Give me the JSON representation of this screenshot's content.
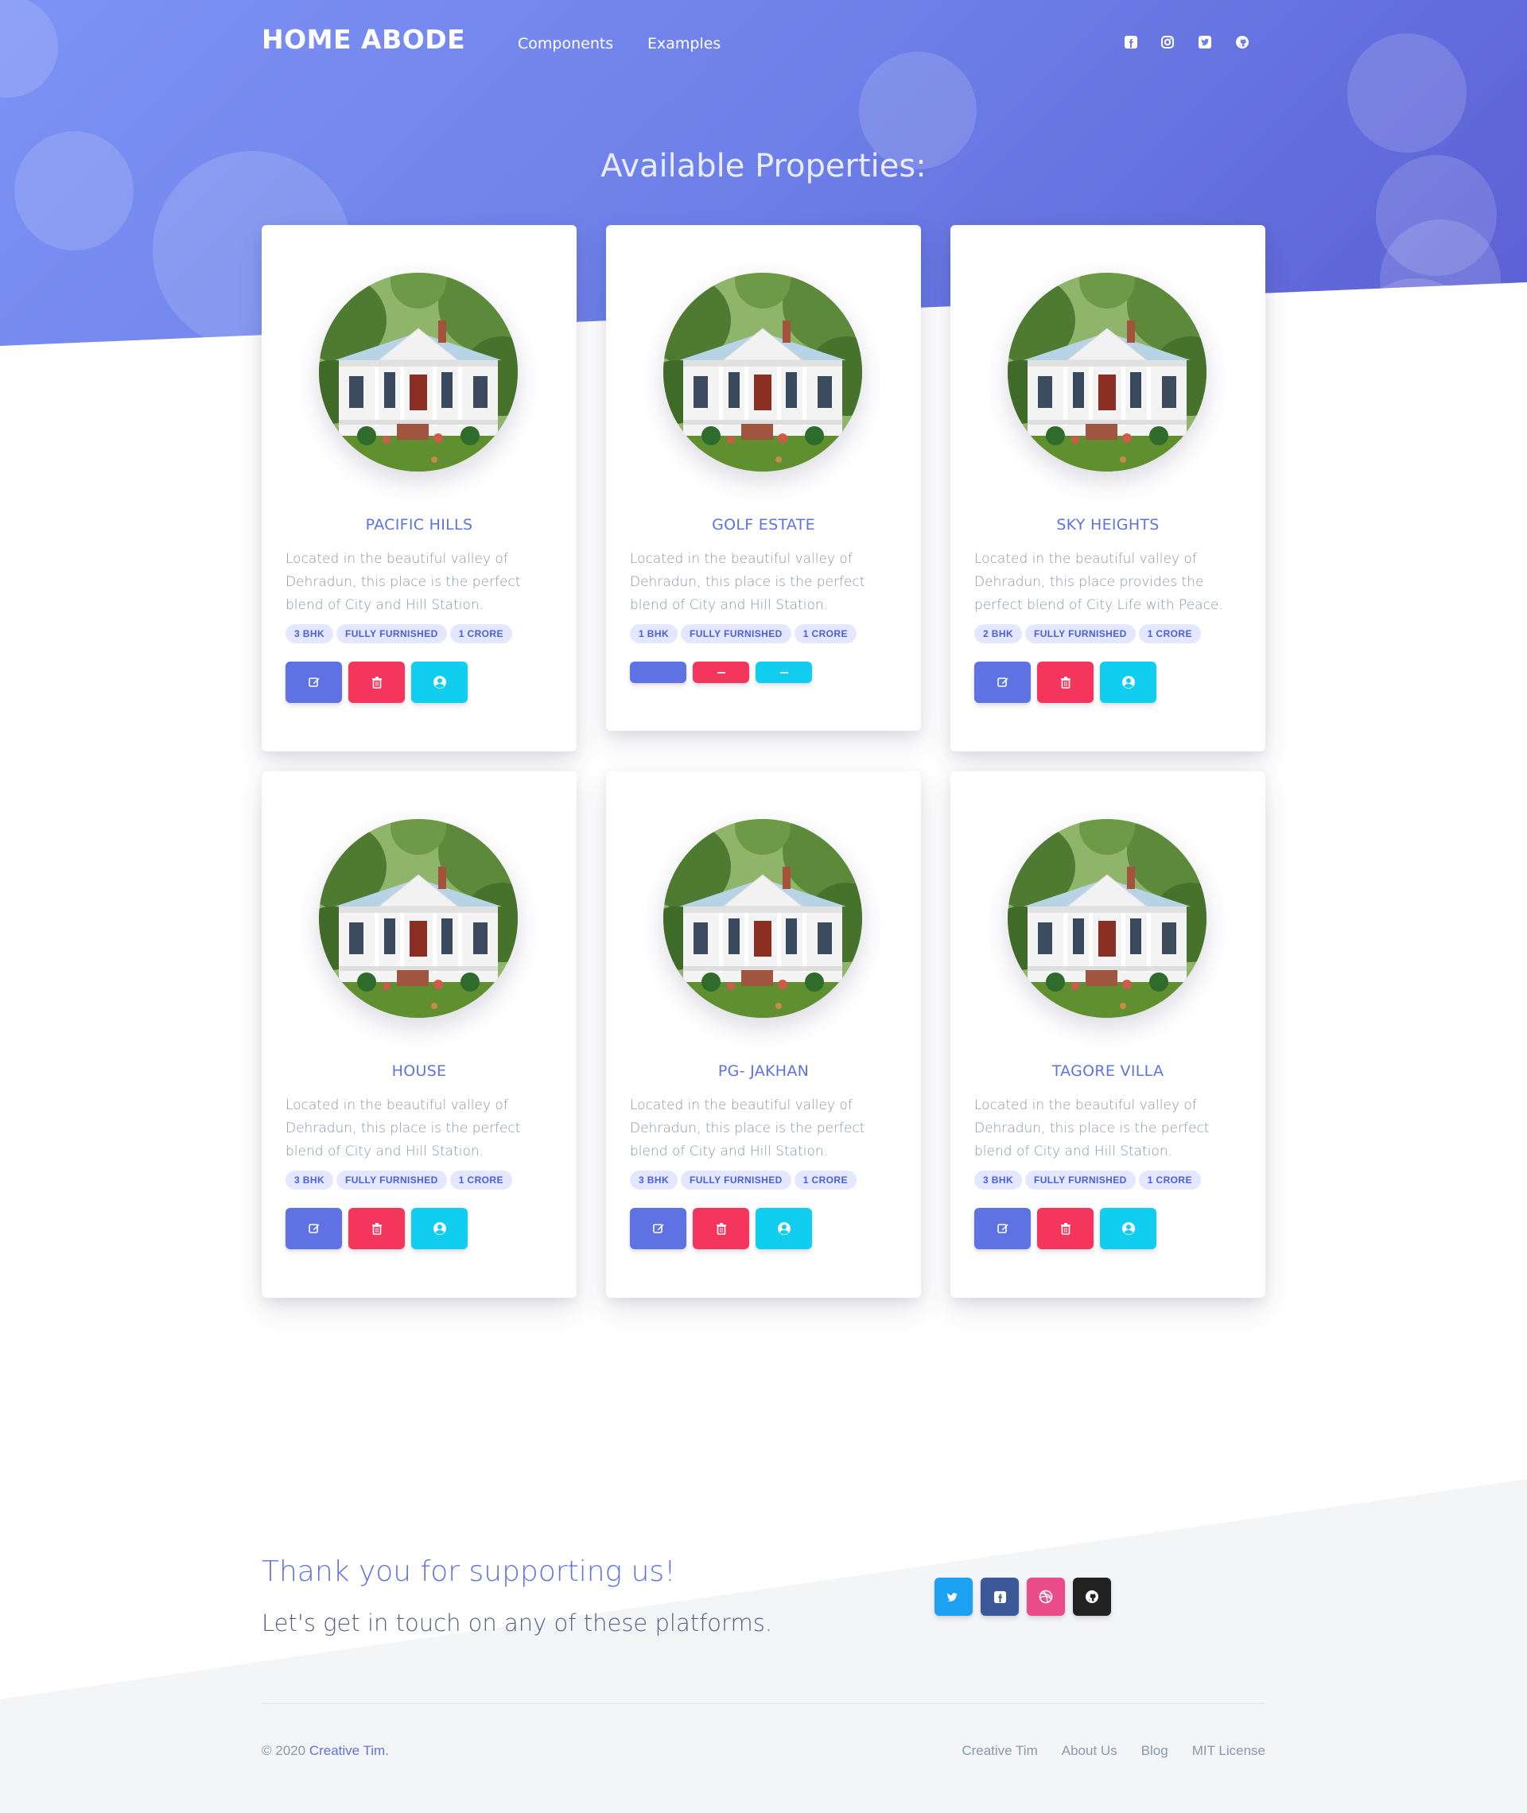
{
  "nav": {
    "brand": "HOME ABODE",
    "links": [
      "Components",
      "Examples"
    ],
    "social_icons": [
      "facebook-square-icon",
      "instagram-icon",
      "twitter-square-icon",
      "github-icon"
    ]
  },
  "section_title": "Available Properties:",
  "colors": {
    "primary": "#5e72e4",
    "danger": "#f5365c",
    "info": "#11cdef",
    "hero_gradient_start": "#7d93f5",
    "hero_gradient_end": "#5b5fd3"
  },
  "properties": [
    {
      "name": "PACIFIC HILLS",
      "desc": "Located in the beautiful valley of Dehradun, this place is the perfect blend of City and Hill Station.",
      "badges": [
        "3 BHK",
        "FULLY FURNISHED",
        "1 CRORE"
      ]
    },
    {
      "name": "GOLF ESTATE",
      "desc": "Located in the beautiful valley of Dehradun, this place is the perfect blend of City and Hill Station.",
      "badges": [
        "1 BHK",
        "FULLY FURNISHED",
        "1 CRORE"
      ]
    },
    {
      "name": "SKY HEIGHTS",
      "desc": "Located in the beautiful valley of Dehradun, this place provides the perfect blend of City Life with Peace.",
      "badges": [
        "2 BHK",
        "FULLY FURNISHED",
        "1 CRORE"
      ]
    },
    {
      "name": "HOUSE",
      "desc": "Located in the beautiful valley of Dehradun, this place is the perfect blend of City and Hill Station.",
      "badges": [
        "3 BHK",
        "FULLY FURNISHED",
        "1 CRORE"
      ]
    },
    {
      "name": "PG- JAKHAN",
      "desc": "Located in the beautiful valley of Dehradun, this place is the perfect blend of City and Hill Station.",
      "badges": [
        "3 BHK",
        "FULLY FURNISHED",
        "1 CRORE"
      ]
    },
    {
      "name": "TAGORE VILLA",
      "desc": "Located in the beautiful valley of Dehradun, this place is the perfect blend of City and Hill Station.",
      "badges": [
        "3 BHK",
        "FULLY FURNISHED",
        "1 CRORE"
      ]
    }
  ],
  "footer": {
    "thanks": "Thank you for supporting us!",
    "touch": "Let's get in touch on any of these platforms.",
    "social": [
      {
        "icon": "twitter-icon",
        "color": "#1da1f2"
      },
      {
        "icon": "facebook-square-icon",
        "color": "#3b5999"
      },
      {
        "icon": "dribbble-icon",
        "color": "#ea4c89"
      },
      {
        "icon": "github-icon",
        "color": "#222222"
      }
    ],
    "copyright_prefix": "© 2020",
    "copyright_link": "Creative Tim.",
    "links": [
      "Creative Tim",
      "About Us",
      "Blog",
      "MIT License"
    ]
  }
}
